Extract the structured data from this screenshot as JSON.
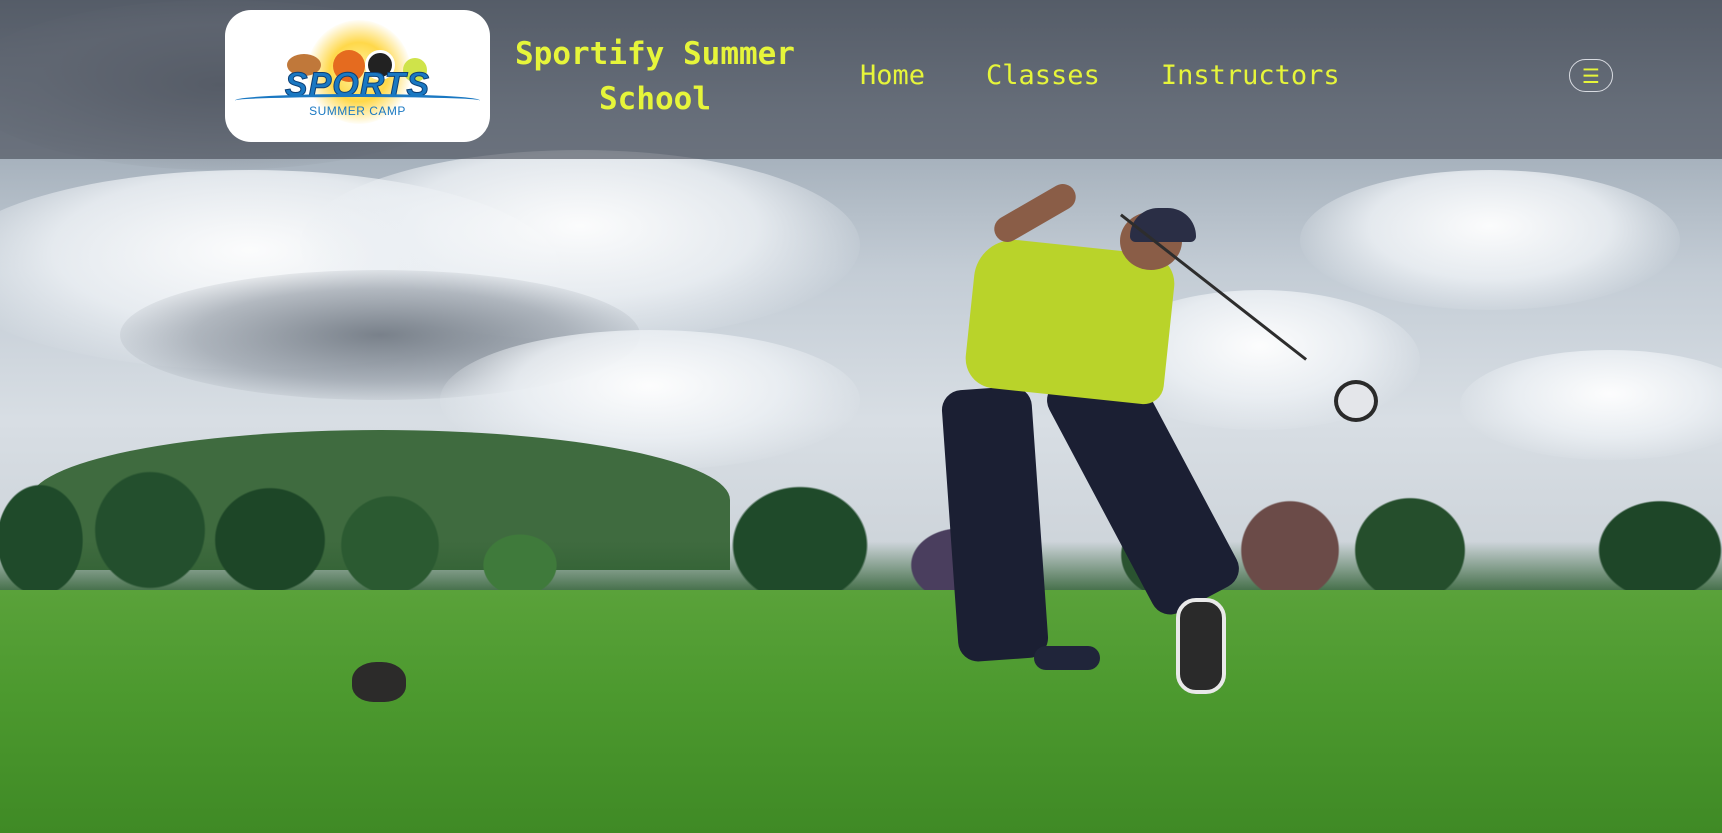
{
  "header": {
    "logo": {
      "wordmark": "SPORTS",
      "subtitle": "SUMMER CAMP"
    },
    "site_title": "Sportify Summer School",
    "nav": [
      {
        "label": "Home"
      },
      {
        "label": "Classes"
      },
      {
        "label": "Instructors"
      }
    ],
    "menu_icon": "hamburger-menu-icon"
  },
  "hero": {
    "image": "golfer-swing-photo"
  },
  "colors": {
    "accent": "#e6f53a",
    "header_overlay": "#464a56",
    "logo_blue": "#1a78c2"
  }
}
